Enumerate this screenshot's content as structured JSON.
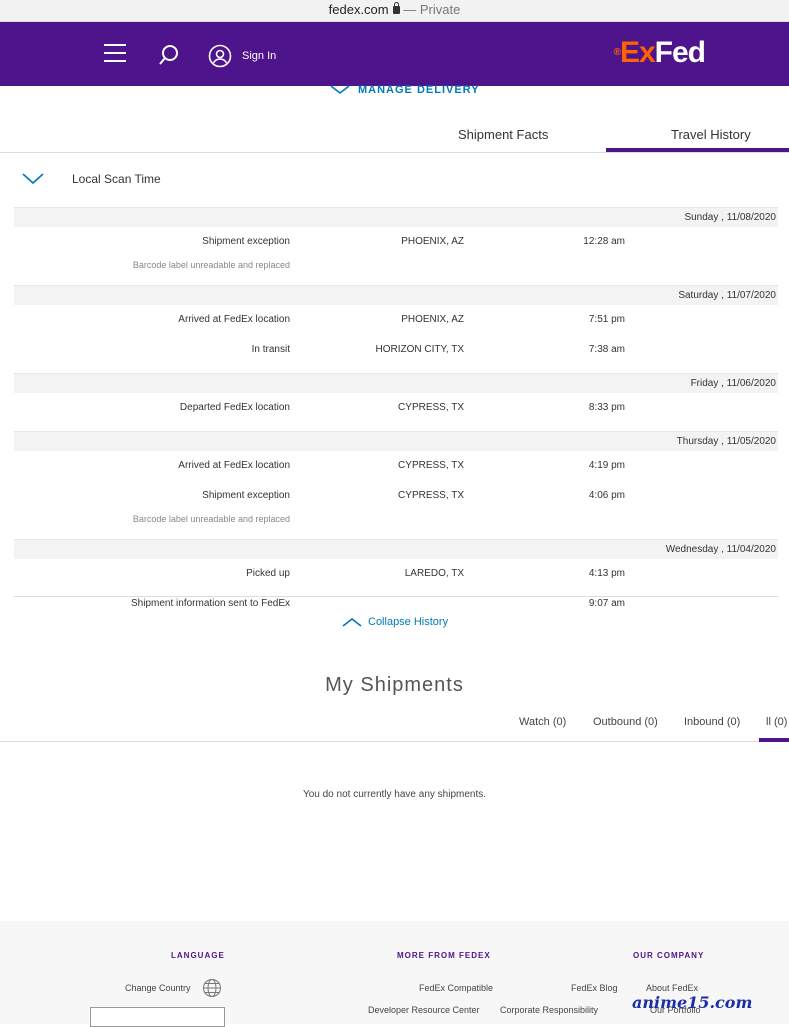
{
  "browser": {
    "url": "fedex.com",
    "separator": "—",
    "mode": "Private"
  },
  "header": {
    "logo_fed": "Fed",
    "logo_ex": "Ex",
    "logo_dot": "®",
    "sign_in": "Sign In",
    "brand_color": "#4d148c",
    "icons": [
      "menu-icon",
      "search-icon",
      "user-icon"
    ]
  },
  "manage_delivery": "MANAGE DELIVERY",
  "tabs": {
    "travel_history": "Travel History",
    "shipment_facts": "Shipment Facts"
  },
  "scan_time_label": "Local Scan Time",
  "history": [
    {
      "date": "Sunday , 11/08/2020",
      "events": [
        {
          "time": "12:28 am",
          "location": "PHOENIX, AZ",
          "status": "Shipment exception",
          "note": "Barcode label unreadable and replaced"
        }
      ]
    },
    {
      "date": "Saturday , 11/07/2020",
      "events": [
        {
          "time": "7:51 pm",
          "location": "PHOENIX, AZ",
          "status": "Arrived at FedEx location",
          "note": ""
        },
        {
          "time": "7:38 am",
          "location": "HORIZON CITY, TX",
          "status": "In transit",
          "note": ""
        }
      ]
    },
    {
      "date": "Friday , 11/06/2020",
      "events": [
        {
          "time": "8:33 pm",
          "location": "CYPRESS, TX",
          "status": "Departed FedEx location",
          "note": ""
        }
      ]
    },
    {
      "date": "Thursday , 11/05/2020",
      "events": [
        {
          "time": "4:19 pm",
          "location": "CYPRESS, TX",
          "status": "Arrived at FedEx location",
          "note": ""
        },
        {
          "time": "4:06 pm",
          "location": "CYPRESS, TX",
          "status": "Shipment exception",
          "note": "Barcode label unreadable and replaced"
        }
      ]
    },
    {
      "date": "Wednesday , 11/04/2020",
      "events": [
        {
          "time": "4:13 pm",
          "location": "LAREDO, TX",
          "status": "Picked up",
          "note": ""
        },
        {
          "time": "9:07 am",
          "location": "",
          "status": "Shipment information sent to FedEx",
          "note": ""
        }
      ]
    }
  ],
  "collapse_history": "Collapse History",
  "my_shipments": {
    "title": "My Shipments",
    "tabs": {
      "all": "ll (0)",
      "inbound": "Inbound (0)",
      "outbound": "Outbound (0)",
      "watch": "Watch (0)"
    },
    "empty_message": "You do not currently have any shipments."
  },
  "footer": {
    "our_company": "OUR COMPANY",
    "more_from_fedex": "MORE FROM FEDEX",
    "language": "LANGUAGE",
    "about_fedex": "About FedEx",
    "fedex_blog": "FedEx Blog",
    "our_portfolio": "Our Portfolio",
    "corporate_responsibility": "Corporate Responsibility",
    "fedex_compatible": "FedEx Compatible",
    "developer_resource_center": "Developer Resource Center",
    "change_country": "Change Country"
  },
  "watermark": "anime15.com"
}
